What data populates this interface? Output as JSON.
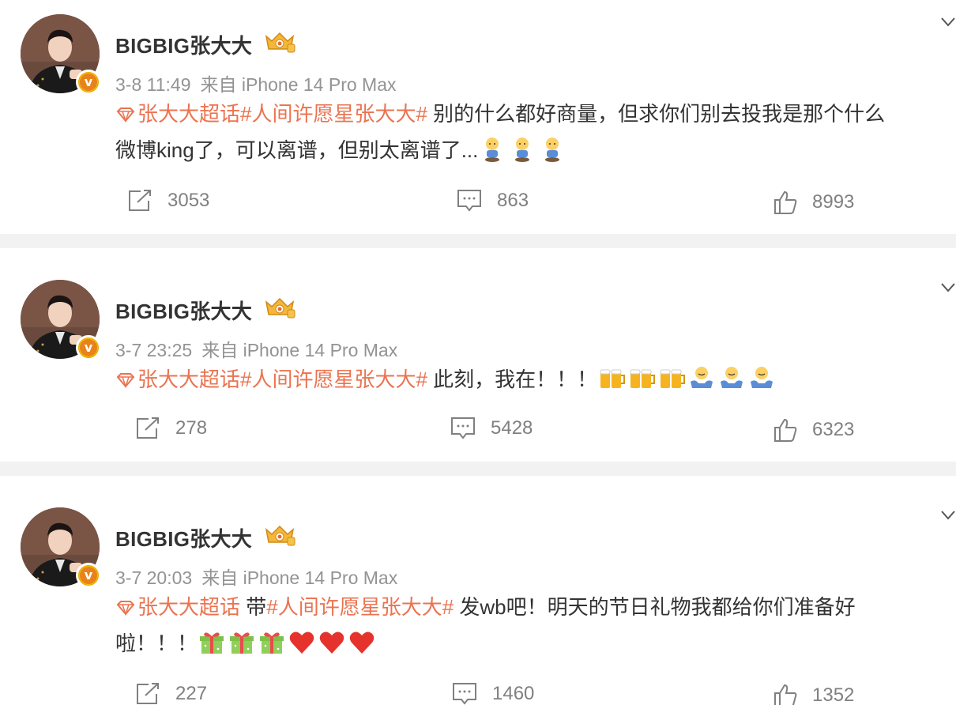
{
  "posts": [
    {
      "author": "BIGBIG张大大",
      "time": "3-8 11:49",
      "source": "来自 iPhone 14 Pro Max",
      "topic1": "张大大超话",
      "connector": "",
      "topic2": "#人间许愿星张大大#",
      "text_line1": " 别的什么都好商量，但求你们别去投我是那个什么",
      "text_line2": "微博king了，可以离谱，但别太离谱了...",
      "emoji": [
        "sad-kneel-icon",
        "sad-kneel-icon",
        "sad-kneel-icon"
      ],
      "repost": "3053",
      "comment": "863",
      "like": "8993"
    },
    {
      "author": "BIGBIG张大大",
      "time": "3-7 23:25",
      "source": "来自 iPhone 14 Pro Max",
      "topic1": "张大大超话",
      "connector": "",
      "topic2": "#人间许愿星张大大#",
      "text_line1": " 此刻，我在！！！",
      "emoji": [
        "beer-icon",
        "beer-icon",
        "beer-icon",
        "hug-icon",
        "hug-icon",
        "hug-icon"
      ],
      "repost": "278",
      "comment": "5428",
      "like": "6323"
    },
    {
      "author": "BIGBIG张大大",
      "time": "3-7 20:03",
      "source": "来自 iPhone 14 Pro Max",
      "topic1": "张大大超话",
      "connector": " 带",
      "topic2": "#人间许愿星张大大#",
      "text_line1": " 发wb吧！明天的节日礼物我都给你们准备好",
      "text_line2": "啦！！！",
      "emoji": [
        "gift-icon",
        "gift-icon",
        "gift-icon",
        "heart-icon",
        "heart-icon",
        "heart-icon"
      ],
      "repost": "227",
      "comment": "1460",
      "like": "1352"
    }
  ],
  "colors": {
    "topic": "#eb7350",
    "text": "#333333",
    "meta": "#939393",
    "divider": "#f2f2f2",
    "badge": "#f7c000"
  }
}
